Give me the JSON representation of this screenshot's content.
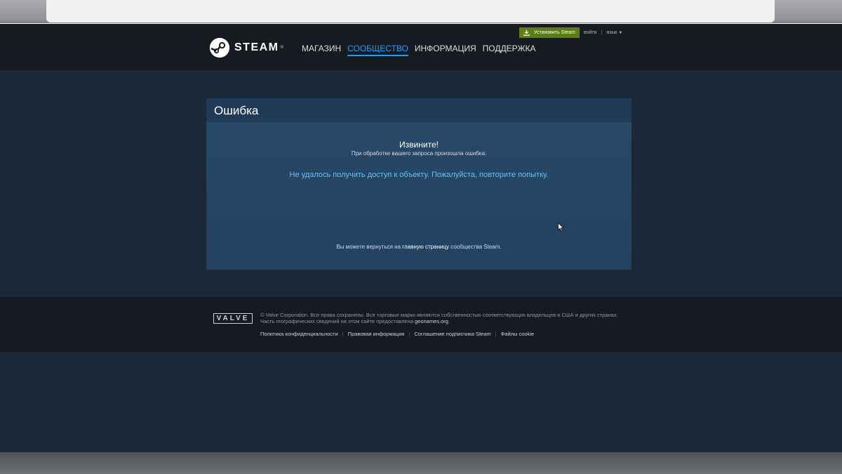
{
  "header": {
    "logo_text": "STEAM",
    "logo_reg": "®",
    "nav": [
      {
        "label": "МАГАЗИН",
        "active": false
      },
      {
        "label": "СООБЩЕСТВО",
        "active": true
      },
      {
        "label": "ИНФОРМАЦИЯ",
        "active": false
      },
      {
        "label": "ПОДДЕРЖКА",
        "active": false
      }
    ],
    "install_label": "Установить Steam",
    "login_label": "войти",
    "separator": "|",
    "language_label": "язык"
  },
  "error": {
    "title": "Ошибка",
    "sorry": "Извините!",
    "subtitle": "При обработке вашего запроса произошла ошибка:",
    "message": "Не удалось получить доступ к объекту. Пожалуйста, повторите попытку.",
    "return_prefix": "Вы можете вернуться на ",
    "return_link": "главную страницу",
    "return_suffix": " сообщества Steam."
  },
  "footer": {
    "valve_logo": "VALVE",
    "legal_line1": "© Valve Corporation. Все права сохранены. Все торговые марки являются собственностью соответствующих владельцев в США и других странах.",
    "legal_line2_prefix": "Часть географических сведений на этом сайте предоставлена ",
    "legal_link": "geonames.org",
    "legal_line2_suffix": ".",
    "links": [
      "Политика конфиденциальности",
      "Правовая информация",
      "Соглашение подписчика Steam",
      "Файлы cookie"
    ],
    "link_separator": "|"
  },
  "colors": {
    "page_bg": "#1b2838",
    "header_bg": "#171a21",
    "accent_link": "#1a9fff",
    "error_text": "#67c1f5",
    "install_button": "#5c7e10"
  },
  "icons": [
    "steam-logo-icon",
    "download-icon",
    "caret-down-icon",
    "mouse-cursor-icon"
  ]
}
